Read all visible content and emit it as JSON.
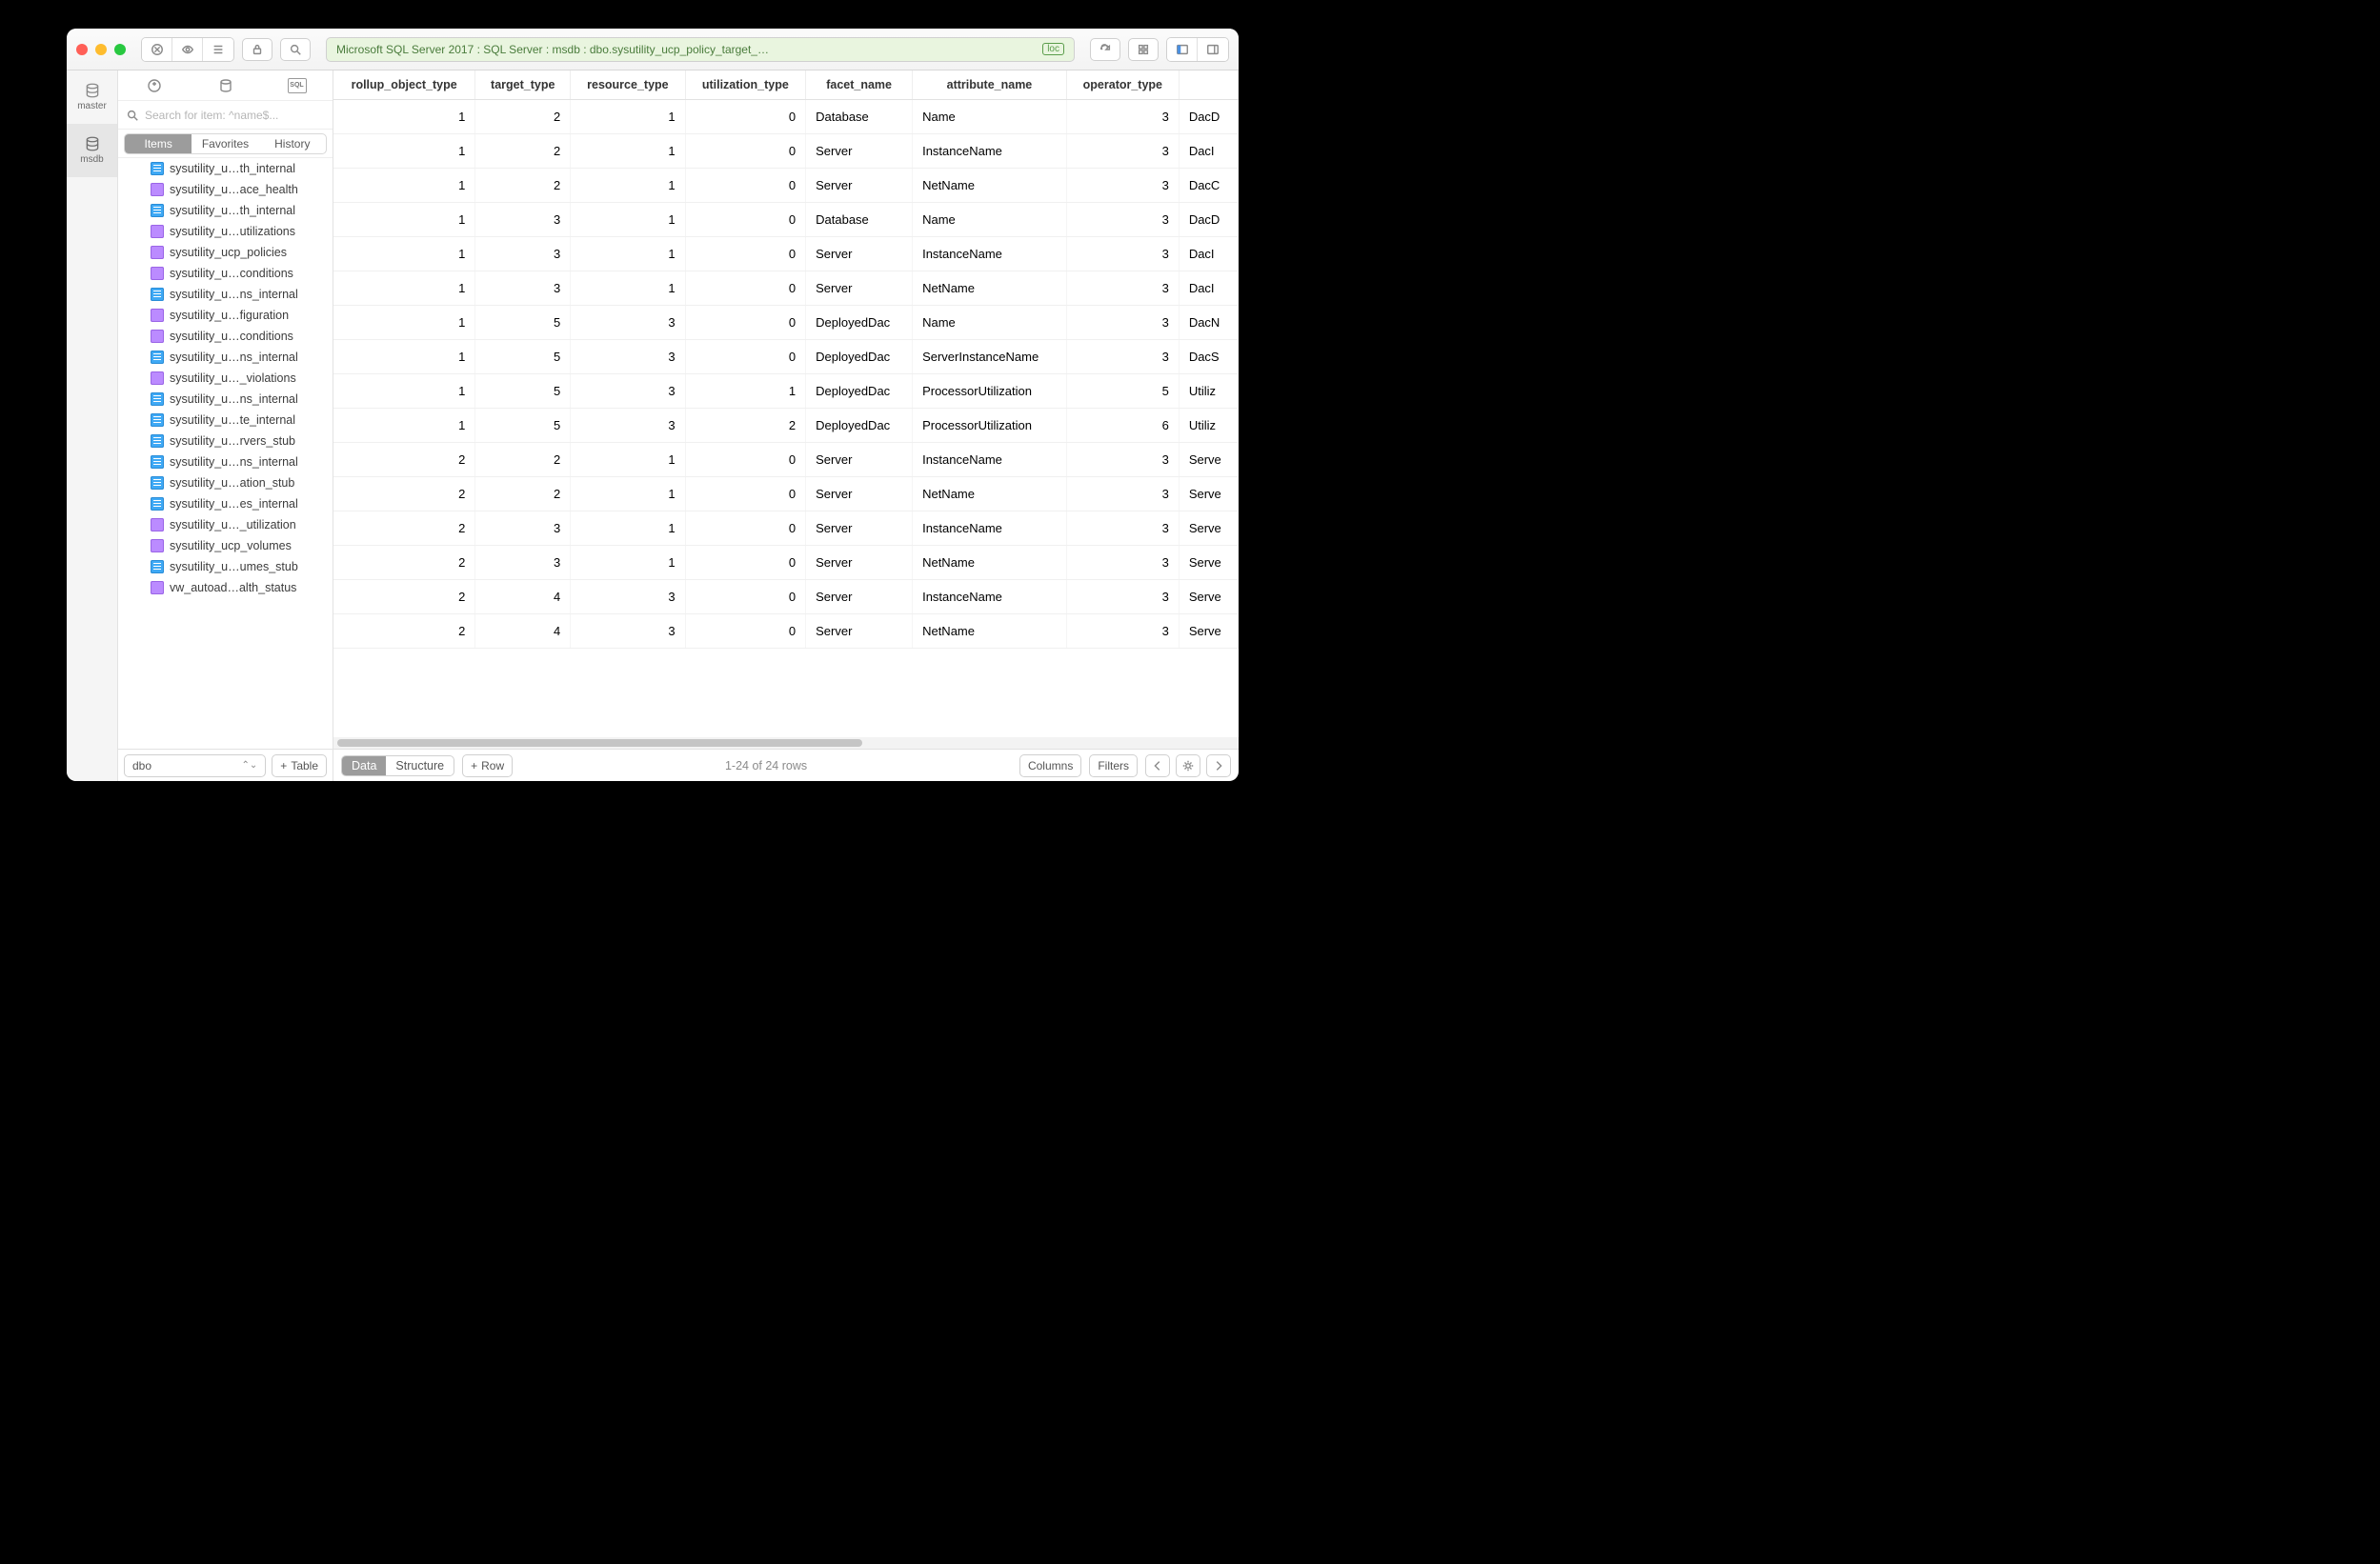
{
  "breadcrumb": "Microsoft SQL Server 2017 : SQL Server : msdb : dbo.sysutility_ucp_policy_target_…",
  "breadcrumb_badge": "loc",
  "rail": {
    "items": [
      "master",
      "msdb"
    ],
    "selected": 1
  },
  "search_placeholder": "Search for item: ^name$...",
  "side_segments": [
    "Items",
    "Favorites",
    "History"
  ],
  "list_items": [
    {
      "k": "t",
      "t": "sysutility_u…th_internal"
    },
    {
      "k": "v",
      "t": "sysutility_u…ace_health"
    },
    {
      "k": "t",
      "t": "sysutility_u…th_internal"
    },
    {
      "k": "v",
      "t": "sysutility_u…utilizations"
    },
    {
      "k": "v",
      "t": "sysutility_ucp_policies"
    },
    {
      "k": "v",
      "t": "sysutility_u…conditions"
    },
    {
      "k": "t",
      "t": "sysutility_u…ns_internal"
    },
    {
      "k": "v",
      "t": "sysutility_u…figuration"
    },
    {
      "k": "v",
      "t": "sysutility_u…conditions"
    },
    {
      "k": "t",
      "t": "sysutility_u…ns_internal"
    },
    {
      "k": "v",
      "t": "sysutility_u…_violations"
    },
    {
      "k": "t",
      "t": "sysutility_u…ns_internal"
    },
    {
      "k": "t",
      "t": "sysutility_u…te_internal"
    },
    {
      "k": "t",
      "t": "sysutility_u…rvers_stub"
    },
    {
      "k": "t",
      "t": "sysutility_u…ns_internal"
    },
    {
      "k": "t",
      "t": "sysutility_u…ation_stub"
    },
    {
      "k": "t",
      "t": "sysutility_u…es_internal"
    },
    {
      "k": "v",
      "t": "sysutility_u…_utilization"
    },
    {
      "k": "v",
      "t": "sysutility_ucp_volumes"
    },
    {
      "k": "t",
      "t": "sysutility_u…umes_stub"
    },
    {
      "k": "v",
      "t": "vw_autoad…alth_status"
    }
  ],
  "schema": "dbo",
  "add_label": "Table",
  "columns": [
    "rollup_object_type",
    "target_type",
    "resource_type",
    "utilization_type",
    "facet_name",
    "attribute_name",
    "operator_type",
    ""
  ],
  "col_align": [
    "num",
    "num",
    "num",
    "num",
    "txt",
    "txt",
    "num",
    "txt"
  ],
  "rows": [
    [
      1,
      2,
      1,
      0,
      "Database",
      "Name",
      3,
      "DacD"
    ],
    [
      1,
      2,
      1,
      0,
      "Server",
      "InstanceName",
      3,
      "DacI"
    ],
    [
      1,
      2,
      1,
      0,
      "Server",
      "NetName",
      3,
      "DacC"
    ],
    [
      1,
      3,
      1,
      0,
      "Database",
      "Name",
      3,
      "DacD"
    ],
    [
      1,
      3,
      1,
      0,
      "Server",
      "InstanceName",
      3,
      "DacI"
    ],
    [
      1,
      3,
      1,
      0,
      "Server",
      "NetName",
      3,
      "DacI"
    ],
    [
      1,
      5,
      3,
      0,
      "DeployedDac",
      "Name",
      3,
      "DacN"
    ],
    [
      1,
      5,
      3,
      0,
      "DeployedDac",
      "ServerInstanceName",
      3,
      "DacS"
    ],
    [
      1,
      5,
      3,
      1,
      "DeployedDac",
      "ProcessorUtilization",
      5,
      "Utiliz"
    ],
    [
      1,
      5,
      3,
      2,
      "DeployedDac",
      "ProcessorUtilization",
      6,
      "Utiliz"
    ],
    [
      2,
      2,
      1,
      0,
      "Server",
      "InstanceName",
      3,
      "Serve"
    ],
    [
      2,
      2,
      1,
      0,
      "Server",
      "NetName",
      3,
      "Serve"
    ],
    [
      2,
      3,
      1,
      0,
      "Server",
      "InstanceName",
      3,
      "Serve"
    ],
    [
      2,
      3,
      1,
      0,
      "Server",
      "NetName",
      3,
      "Serve"
    ],
    [
      2,
      4,
      3,
      0,
      "Server",
      "InstanceName",
      3,
      "Serve"
    ],
    [
      2,
      4,
      3,
      0,
      "Server",
      "NetName",
      3,
      "Serve"
    ]
  ],
  "status_segments": [
    "Data",
    "Structure"
  ],
  "row_btn_label": "Row",
  "row_count_label": "1-24 of 24 rows",
  "columns_btn": "Columns",
  "filters_btn": "Filters"
}
